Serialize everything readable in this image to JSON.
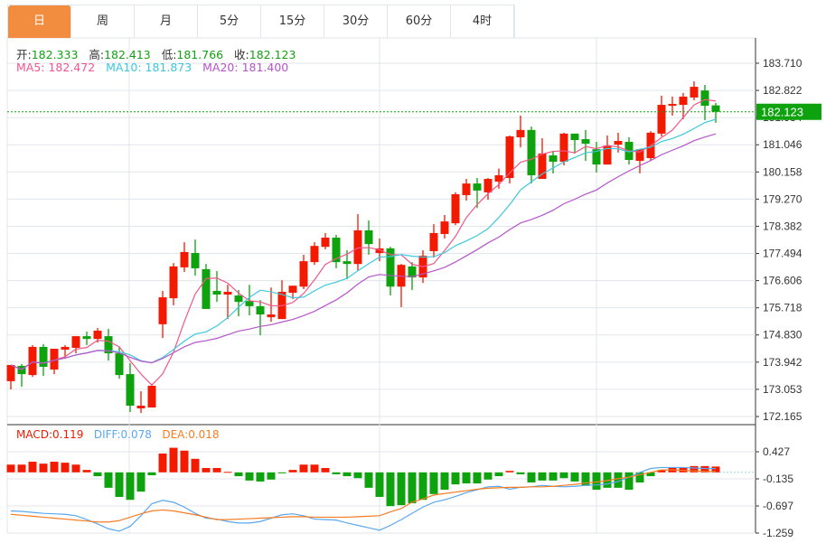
{
  "tabs": [
    {
      "label": "日",
      "active": true
    },
    {
      "label": "周",
      "active": false
    },
    {
      "label": "月",
      "active": false
    },
    {
      "label": "5分",
      "active": false
    },
    {
      "label": "15分",
      "active": false
    },
    {
      "label": "30分",
      "active": false
    },
    {
      "label": "60分",
      "active": false
    },
    {
      "label": "4时",
      "active": false
    }
  ],
  "ohlc_legend": {
    "open_label": "开:",
    "open": "182.333",
    "high_label": "高:",
    "high": "182.413",
    "low_label": "低:",
    "low": "181.766",
    "close_label": "收:",
    "close": "182.123"
  },
  "ma_legend": {
    "ma5": "MA5: 182.472",
    "ma10": "MA10: 181.873",
    "ma20": "MA20: 181.400"
  },
  "macd_legend": {
    "macd": "MACD:0.119",
    "diff": "DIFF:0.078",
    "dea": "DEA:0.018"
  },
  "current_price": "182.123",
  "colors": {
    "up": "#f21a00",
    "down": "#0ea20e",
    "ma5": "#f0578a",
    "ma10": "#3cc8dc",
    "ma20": "#b455c8",
    "diff": "#5aa8f0",
    "dea": "#f57c22",
    "tab_active": "#f28c3f",
    "price_tag": "#0ea20e"
  },
  "chart_data": {
    "type": "candlestick",
    "price_axis_ticks": [
      "183.710",
      "182.822",
      "181.934",
      "181.046",
      "180.158",
      "179.270",
      "178.382",
      "177.494",
      "176.606",
      "175.718",
      "174.830",
      "173.942",
      "173.053",
      "172.165"
    ],
    "price_range": [
      172.165,
      183.71
    ],
    "macd_axis_ticks": [
      "0.427",
      "-0.135",
      "-0.697",
      "-1.259"
    ],
    "macd_range": [
      -1.259,
      0.427
    ],
    "candles": [
      [
        173.32,
        173.85,
        173.05,
        173.85
      ],
      [
        173.82,
        173.88,
        173.14,
        173.55
      ],
      [
        173.52,
        174.5,
        173.46,
        174.44
      ],
      [
        174.44,
        174.53,
        173.49,
        173.79
      ],
      [
        173.7,
        174.38,
        173.55,
        174.38
      ],
      [
        174.35,
        174.5,
        174.05,
        174.44
      ],
      [
        174.41,
        174.79,
        174.23,
        174.79
      ],
      [
        174.79,
        174.94,
        174.5,
        174.7
      ],
      [
        174.7,
        175.06,
        174.58,
        174.97
      ],
      [
        174.79,
        175.03,
        173.99,
        174.23
      ],
      [
        174.23,
        174.44,
        173.4,
        173.52
      ],
      [
        173.55,
        173.91,
        172.31,
        172.52
      ],
      [
        172.43,
        172.99,
        172.28,
        172.52
      ],
      [
        172.46,
        173.23,
        172.46,
        173.17
      ],
      [
        175.18,
        176.27,
        174.73,
        176.06
      ],
      [
        176.03,
        177.18,
        175.8,
        177.07
      ],
      [
        177.04,
        177.86,
        176.89,
        177.54
      ],
      [
        177.51,
        177.95,
        176.77,
        177.01
      ],
      [
        176.98,
        177.15,
        175.68,
        175.68
      ],
      [
        176.27,
        176.92,
        175.91,
        176.15
      ],
      [
        176.15,
        176.47,
        175.35,
        176.24
      ],
      [
        176.12,
        176.3,
        175.44,
        175.91
      ],
      [
        175.94,
        176.47,
        175.47,
        175.77
      ],
      [
        175.77,
        175.97,
        174.82,
        175.5
      ],
      [
        175.41,
        176.38,
        175.26,
        175.5
      ],
      [
        175.35,
        176.62,
        175.35,
        176.24
      ],
      [
        176.21,
        176.44,
        176.0,
        176.44
      ],
      [
        176.41,
        177.45,
        176.33,
        177.24
      ],
      [
        177.21,
        177.86,
        177.12,
        177.74
      ],
      [
        177.71,
        178.16,
        177.63,
        178.01
      ],
      [
        178.01,
        178.1,
        177.01,
        177.21
      ],
      [
        177.24,
        177.6,
        176.65,
        177.15
      ],
      [
        177.15,
        178.78,
        176.92,
        178.25
      ],
      [
        178.25,
        178.57,
        177.45,
        177.8
      ],
      [
        177.51,
        177.98,
        177.24,
        177.66
      ],
      [
        177.66,
        177.71,
        176.12,
        176.41
      ],
      [
        176.41,
        177.15,
        175.74,
        177.12
      ],
      [
        177.07,
        177.21,
        176.3,
        176.71
      ],
      [
        176.71,
        177.6,
        176.53,
        177.42
      ],
      [
        177.57,
        178.45,
        177.36,
        178.16
      ],
      [
        178.13,
        178.75,
        177.98,
        178.54
      ],
      [
        178.48,
        179.49,
        178.42,
        179.43
      ],
      [
        179.4,
        179.93,
        179.22,
        179.78
      ],
      [
        179.78,
        179.96,
        178.98,
        179.55
      ],
      [
        179.49,
        179.96,
        179.25,
        179.93
      ],
      [
        179.84,
        180.27,
        179.61,
        180.05
      ],
      [
        179.96,
        181.35,
        179.78,
        181.32
      ],
      [
        181.29,
        182.0,
        180.96,
        181.53
      ],
      [
        181.53,
        181.64,
        179.78,
        180.05
      ],
      [
        179.93,
        181.26,
        179.93,
        180.76
      ],
      [
        180.7,
        180.85,
        180.11,
        180.49
      ],
      [
        180.49,
        181.44,
        180.37,
        181.41
      ],
      [
        181.41,
        181.41,
        180.76,
        181.2
      ],
      [
        181.23,
        181.53,
        180.52,
        181.08
      ],
      [
        180.9,
        181.14,
        180.14,
        180.4
      ],
      [
        180.4,
        181.35,
        180.4,
        181.02
      ],
      [
        181.05,
        181.44,
        180.79,
        181.17
      ],
      [
        181.14,
        181.29,
        180.4,
        180.55
      ],
      [
        180.52,
        180.9,
        180.11,
        180.9
      ],
      [
        180.61,
        181.49,
        180.52,
        181.44
      ],
      [
        181.41,
        182.65,
        181.32,
        182.35
      ],
      [
        182.32,
        182.62,
        182.0,
        182.38
      ],
      [
        182.35,
        182.74,
        181.88,
        182.62
      ],
      [
        182.59,
        183.12,
        182.5,
        182.94
      ],
      [
        182.82,
        183.0,
        181.85,
        182.32
      ],
      [
        182.333,
        182.413,
        181.766,
        182.123
      ]
    ],
    "macd_hist": [
      0.16,
      0.16,
      0.22,
      0.18,
      0.22,
      0.2,
      0.16,
      0.05,
      -0.08,
      -0.32,
      -0.51,
      -0.57,
      -0.4,
      -0.06,
      0.39,
      0.51,
      0.45,
      0.28,
      0.09,
      0.09,
      0.01,
      -0.08,
      -0.17,
      -0.19,
      -0.15,
      -0.02,
      0.05,
      0.16,
      0.16,
      0.09,
      -0.04,
      -0.08,
      -0.12,
      -0.32,
      -0.51,
      -0.7,
      -0.68,
      -0.64,
      -0.57,
      -0.45,
      -0.36,
      -0.25,
      -0.23,
      -0.23,
      -0.15,
      -0.08,
      0.03,
      -0.04,
      -0.21,
      -0.17,
      -0.17,
      -0.12,
      -0.19,
      -0.28,
      -0.36,
      -0.32,
      -0.32,
      -0.36,
      -0.21,
      -0.08,
      0.05,
      0.09,
      0.09,
      0.13,
      0.13,
      0.12
    ],
    "diff": [
      -0.8,
      -0.81,
      -0.83,
      -0.85,
      -0.86,
      -0.87,
      -0.9,
      -0.98,
      -1.07,
      -1.17,
      -1.22,
      -1.12,
      -0.9,
      -0.65,
      -0.58,
      -0.62,
      -0.72,
      -0.85,
      -0.95,
      -0.97,
      -1.02,
      -1.05,
      -1.05,
      -1.02,
      -0.95,
      -0.88,
      -0.86,
      -0.9,
      -0.97,
      -0.98,
      -0.99,
      -1.05,
      -1.1,
      -1.15,
      -1.2,
      -1.1,
      -0.98,
      -0.85,
      -0.72,
      -0.62,
      -0.57,
      -0.5,
      -0.42,
      -0.36,
      -0.3,
      -0.29,
      -0.35,
      -0.31,
      -0.3,
      -0.27,
      -0.29,
      -0.3,
      -0.29,
      -0.27,
      -0.26,
      -0.24,
      -0.19,
      -0.1,
      0.0,
      0.08,
      0.1,
      0.1,
      0.1,
      0.09,
      0.08,
      0.078
    ],
    "dea": [
      -0.87,
      -0.89,
      -0.91,
      -0.93,
      -0.95,
      -0.97,
      -0.99,
      -1.01,
      -1.03,
      -1.03,
      -1.0,
      -0.93,
      -0.86,
      -0.8,
      -0.78,
      -0.8,
      -0.84,
      -0.88,
      -0.93,
      -0.98,
      -0.98,
      -0.97,
      -0.96,
      -0.95,
      -0.94,
      -0.93,
      -0.92,
      -0.92,
      -0.93,
      -0.93,
      -0.93,
      -0.93,
      -0.92,
      -0.91,
      -0.9,
      -0.82,
      -0.75,
      -0.62,
      -0.55,
      -0.47,
      -0.44,
      -0.41,
      -0.38,
      -0.35,
      -0.33,
      -0.32,
      -0.31,
      -0.31,
      -0.3,
      -0.3,
      -0.29,
      -0.27,
      -0.25,
      -0.22,
      -0.2,
      -0.17,
      -0.13,
      -0.1,
      -0.05,
      0.0,
      0.05,
      0.05,
      0.04,
      0.03,
      0.02,
      0.018
    ],
    "grid": true
  }
}
